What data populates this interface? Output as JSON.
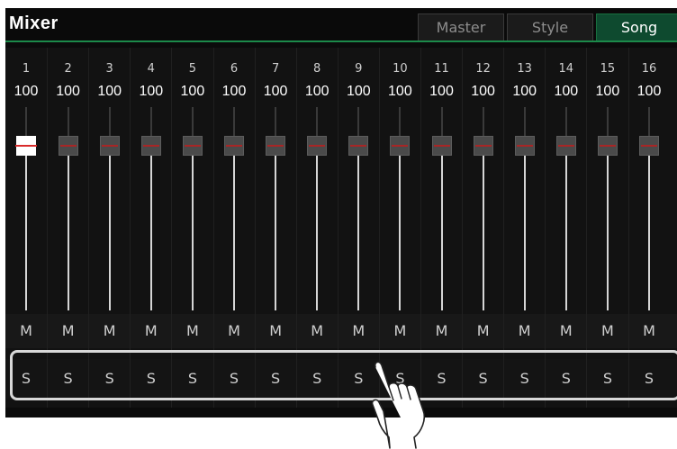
{
  "title": "Mixer",
  "tabs": [
    {
      "label": "Master",
      "active": false
    },
    {
      "label": "Style",
      "active": false
    },
    {
      "label": "Song",
      "active": true
    }
  ],
  "channels": [
    {
      "number": "1",
      "volume": "100",
      "mute": "M",
      "solo": "S",
      "selected": true
    },
    {
      "number": "2",
      "volume": "100",
      "mute": "M",
      "solo": "S",
      "selected": false
    },
    {
      "number": "3",
      "volume": "100",
      "mute": "M",
      "solo": "S",
      "selected": false
    },
    {
      "number": "4",
      "volume": "100",
      "mute": "M",
      "solo": "S",
      "selected": false
    },
    {
      "number": "5",
      "volume": "100",
      "mute": "M",
      "solo": "S",
      "selected": false
    },
    {
      "number": "6",
      "volume": "100",
      "mute": "M",
      "solo": "S",
      "selected": false
    },
    {
      "number": "7",
      "volume": "100",
      "mute": "M",
      "solo": "S",
      "selected": false
    },
    {
      "number": "8",
      "volume": "100",
      "mute": "M",
      "solo": "S",
      "selected": false
    },
    {
      "number": "9",
      "volume": "100",
      "mute": "M",
      "solo": "S",
      "selected": false
    },
    {
      "number": "10",
      "volume": "100",
      "mute": "M",
      "solo": "S",
      "selected": false
    },
    {
      "number": "11",
      "volume": "100",
      "mute": "M",
      "solo": "S",
      "selected": false
    },
    {
      "number": "12",
      "volume": "100",
      "mute": "M",
      "solo": "S",
      "selected": false
    },
    {
      "number": "13",
      "volume": "100",
      "mute": "M",
      "solo": "S",
      "selected": false
    },
    {
      "number": "14",
      "volume": "100",
      "mute": "M",
      "solo": "S",
      "selected": false
    },
    {
      "number": "15",
      "volume": "100",
      "mute": "M",
      "solo": "S",
      "selected": false
    },
    {
      "number": "16",
      "volume": "100",
      "mute": "M",
      "solo": "S",
      "selected": false
    }
  ],
  "colors": {
    "accent": "#1c8a4a",
    "active_tab": "#0e4a2f",
    "fader_marker": "#a82626"
  }
}
